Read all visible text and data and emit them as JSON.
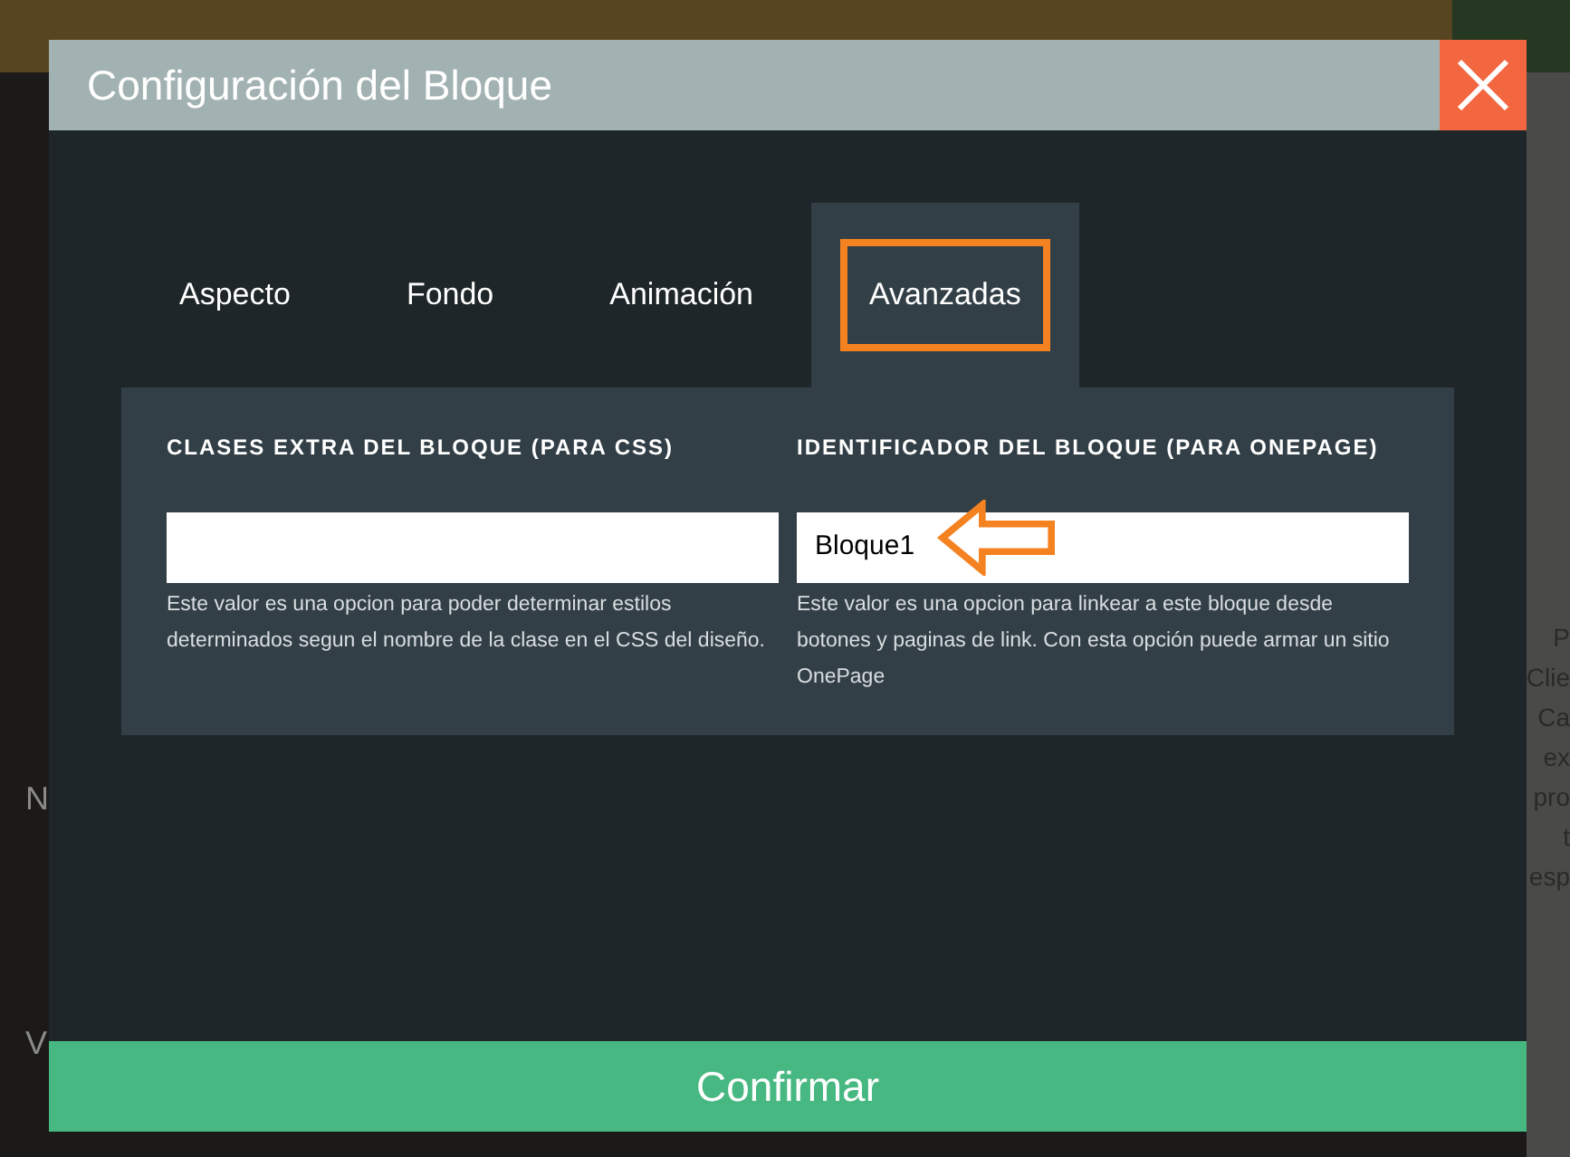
{
  "background": {
    "left_texts": [
      "N",
      "V"
    ],
    "right_texts": [
      "P",
      "Clie",
      "Ca",
      "ex",
      "pro",
      "t",
      "esp"
    ]
  },
  "dialog": {
    "title": "Configuración del Bloque",
    "tabs": [
      {
        "label": "Aspecto",
        "selected": false
      },
      {
        "label": "Fondo",
        "selected": false
      },
      {
        "label": "Animación",
        "selected": false
      },
      {
        "label": "Avanzadas",
        "selected": true,
        "highlighted": true
      }
    ],
    "fields": [
      {
        "label": "CLASES EXTRA DEL BLOQUE (PARA CSS)",
        "help": "Este valor es una opcion para poder determinar estilos determinados segun el nombre de la clase en el CSS del diseño."
      },
      {
        "label": "IDENTIFICADOR DEL BLOQUE (PARA ONEPAGE)",
        "value": "Bloque1",
        "help": "Este valor es una opcion para linkear a este bloque desde botones y paginas de link. Con esta opción puede armar un sitio OnePage",
        "pointed": true
      }
    ],
    "confirm": "Confirmar"
  }
}
